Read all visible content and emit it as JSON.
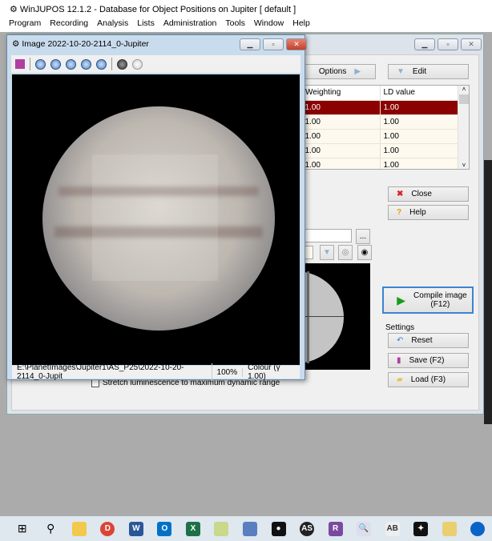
{
  "app": {
    "title": "WinJUPOS 12.1.2 - Database for Object Positions on Jupiter  [ default ]",
    "menu": [
      "Program",
      "Recording",
      "Analysis",
      "Lists",
      "Administration",
      "Tools",
      "Window",
      "Help"
    ]
  },
  "dialog": {
    "options_label": "Options",
    "edit_label": "Edit",
    "table": {
      "columns": [
        "Weighting",
        "LD value"
      ],
      "rows": [
        [
          "1.00",
          "1.00"
        ],
        [
          "1.00",
          "1.00"
        ],
        [
          "1.00",
          "1.00"
        ],
        [
          "1.00",
          "1.00"
        ],
        [
          "1.00",
          "1.00"
        ]
      ],
      "selected_row": 0
    },
    "close_label": "Close",
    "help_label": "Help",
    "browse_label": "...",
    "compile_label": "Compile image",
    "compile_shortcut": "(F12)",
    "settings_label": "Settings",
    "reset_label": "Reset",
    "save_label": "Save (F2)",
    "load_label": "Load (F3)",
    "checkbox_label": "Stretch luminescence to maximum dynamic range",
    "accent_selected": "#8b0000"
  },
  "image_window": {
    "title": "Image  2022-10-20-2114_0-Jupiter",
    "toolbar": [
      "save-icon",
      "zoom-out-icon",
      "zoom-reset-icon",
      "zoom-in-icon",
      "stretch-vertical-icon",
      "stretch-horizontal-icon",
      "dark-circle-icon",
      "light-circle-icon"
    ],
    "status_path": "E:\\PlanetImages\\Jupiter1\\AS_P25\\2022-10-20-2114_0-Jupit",
    "status_zoom": "100%",
    "status_colour": "Colour (γ 1.00)"
  },
  "taskbar": [
    "start",
    "search",
    "file-explorer",
    "chrome",
    "word",
    "outlook",
    "excel",
    "notepad-app",
    "network-app",
    "film-app",
    "asi-app",
    "registax",
    "magnifier-app",
    "ab-app",
    "telescope-app",
    "paint-app",
    "onedrive"
  ]
}
